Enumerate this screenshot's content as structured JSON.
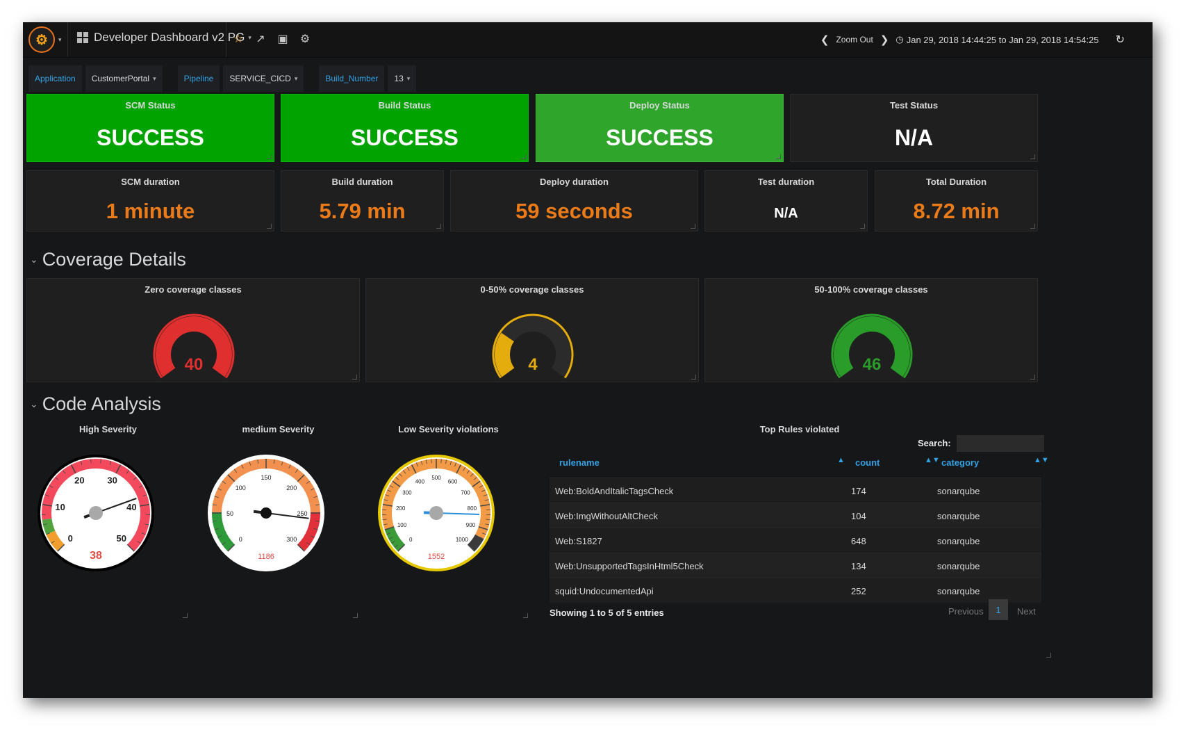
{
  "header": {
    "dashboard_title": "Developer Dashboard v2 PG",
    "zoom_out": "Zoom Out",
    "time_range": "Jan 29, 2018 14:44:25 to Jan 29, 2018 14:54:25",
    "icons": [
      "grafana-logo-icon",
      "star-icon",
      "share-icon",
      "save-icon",
      "gear-icon",
      "chevron-left-icon",
      "chevron-right-icon",
      "clock-icon",
      "refresh-icon"
    ]
  },
  "variables": [
    {
      "label": "Application",
      "value": "CustomerPortal"
    },
    {
      "label": "Pipeline",
      "value": "SERVICE_CICD"
    },
    {
      "label": "Build_Number",
      "value": "13"
    }
  ],
  "status_panels": [
    {
      "title": "SCM Status",
      "value": "SUCCESS",
      "color": "#00a300"
    },
    {
      "title": "Build Status",
      "value": "SUCCESS",
      "color": "#00a300"
    },
    {
      "title": "Deploy Status",
      "value": "SUCCESS",
      "color": "#2fa52b"
    },
    {
      "title": "Test Status",
      "value": "N/A",
      "color": "#1f1f20"
    }
  ],
  "duration_panels": [
    {
      "title": "SCM duration",
      "value": "1 minute"
    },
    {
      "title": "Build duration",
      "value": "5.79 min"
    },
    {
      "title": "Deploy duration",
      "value": "59 seconds"
    },
    {
      "title": "Test duration",
      "value": "N/A"
    },
    {
      "title": "Total Duration",
      "value": "8.72 min"
    }
  ],
  "coverage": {
    "row_title": "Coverage Details",
    "panels": [
      {
        "title": "Zero coverage classes",
        "value": "40",
        "fraction": 1.0,
        "color": "#e02f2f"
      },
      {
        "title": "0-50% coverage classes",
        "value": "4",
        "fraction": 0.28,
        "color": "#e5ac0e"
      },
      {
        "title": "50-100% coverage classes",
        "value": "46",
        "fraction": 1.0,
        "color": "#299c29"
      }
    ]
  },
  "code_analysis": {
    "row_title": "Code Analysis",
    "gauges": [
      {
        "title": "High Severity",
        "value": "38",
        "reading": 38,
        "min": 0,
        "max": 50,
        "ticks": [
          "0",
          "10",
          "20",
          "30",
          "40",
          "50"
        ],
        "rim": "#000000"
      },
      {
        "title": "medium Severity",
        "value": "1186",
        "reading": 1186,
        "min": 0,
        "max": 300,
        "ticks": [
          "0",
          "50",
          "100",
          "150",
          "200",
          "250",
          "300"
        ],
        "rim": "#ffffff"
      },
      {
        "title": "Low Severity violations",
        "value": "1552",
        "reading": 1552,
        "min": 0,
        "max": 1000,
        "ticks": [
          "0",
          "100",
          "200",
          "300",
          "400",
          "500",
          "600",
          "700",
          "800",
          "900",
          "1000"
        ],
        "rim": "#e5c800"
      }
    ],
    "table": {
      "title": "Top Rules violated",
      "search_label": "Search:",
      "columns": [
        "rulename",
        "count",
        "category"
      ],
      "rows": [
        {
          "rulename": "Web:BoldAndItalicTagsCheck",
          "count": "174",
          "category": "sonarqube"
        },
        {
          "rulename": "Web:ImgWithoutAltCheck",
          "count": "104",
          "category": "sonarqube"
        },
        {
          "rulename": "Web:S1827",
          "count": "648",
          "category": "sonarqube"
        },
        {
          "rulename": "Web:UnsupportedTagsInHtml5Check",
          "count": "134",
          "category": "sonarqube"
        },
        {
          "rulename": "squid:UndocumentedApi",
          "count": "252",
          "category": "sonarqube"
        }
      ],
      "info": "Showing 1 to 5 of 5 entries",
      "previous": "Previous",
      "page": "1",
      "next": "Next"
    }
  },
  "colors": {
    "orange_value": "#eb7b18",
    "link_blue": "#33a2e5",
    "background": "#161719",
    "panel": "#1f1f20"
  }
}
